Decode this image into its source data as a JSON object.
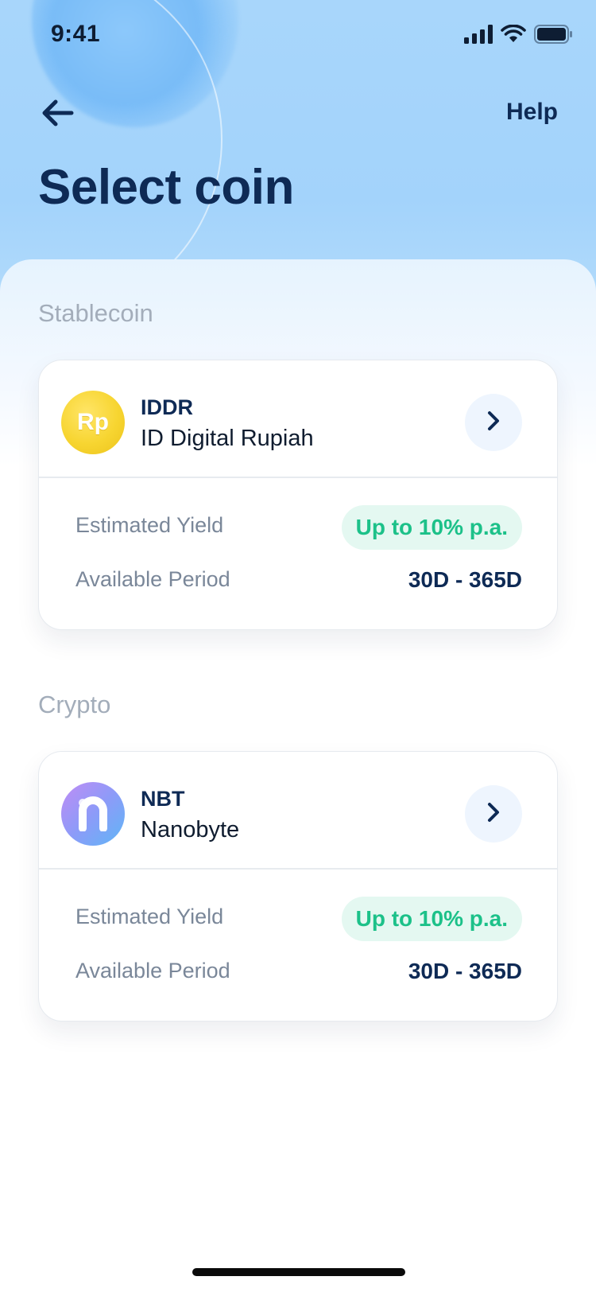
{
  "status_bar": {
    "time": "9:41",
    "icons": [
      "signal-icon",
      "wifi-icon",
      "battery-icon"
    ]
  },
  "nav": {
    "back_icon": "arrow-left-icon",
    "help_label": "Help"
  },
  "page_title": "Select coin",
  "sections": [
    {
      "label": "Stablecoin",
      "coin": {
        "logo_text": "Rp",
        "ticker": "IDDR",
        "name": "ID Digital Rupiah",
        "yield_label": "Estimated Yield",
        "yield_value": "Up to 10% p.a.",
        "period_label": "Available Period",
        "period_value": "30D - 365D"
      }
    },
    {
      "label": "Crypto",
      "coin": {
        "logo_text": "",
        "ticker": "NBT",
        "name": "Nanobyte",
        "yield_label": "Estimated Yield",
        "yield_value": "Up to 10% p.a.",
        "period_label": "Available Period",
        "period_value": "30D - 365D"
      }
    }
  ],
  "colors": {
    "primary_text": "#0e2a55",
    "yield_green": "#1cc189",
    "yield_bg": "#e4f8f1",
    "header_blue": "#a8d6fb"
  }
}
